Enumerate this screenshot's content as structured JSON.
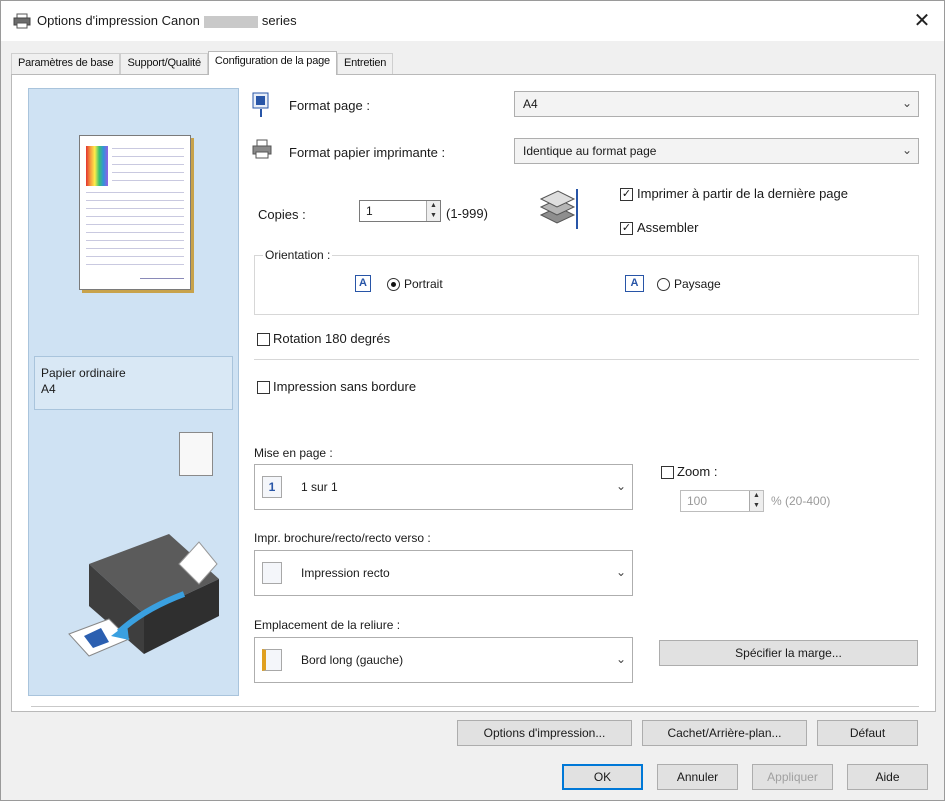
{
  "window": {
    "title_prefix": "Options d'impression Canon",
    "title_suffix": "series",
    "close_glyph": "✕"
  },
  "tabs": [
    {
      "label": "Paramètres de base",
      "active": false
    },
    {
      "label": "Support/Qualité",
      "active": false
    },
    {
      "label": "Configuration de la page",
      "active": true
    },
    {
      "label": "Entretien",
      "active": false
    }
  ],
  "preview": {
    "media_type": "Papier ordinaire",
    "media_size": "A4"
  },
  "page_setup": {
    "page_size_label": "Format page :",
    "page_size_value": "A4",
    "printer_paper_label": "Format papier imprimante :",
    "printer_paper_value": "Identique au format page",
    "copies_label": "Copies :",
    "copies_value": "1",
    "copies_range": "(1-999)",
    "print_from_last_label": "Imprimer à partir de la dernière page",
    "print_from_last_checked": true,
    "collate_label": "Assembler",
    "collate_checked": true,
    "orientation_label": "Orientation :",
    "portrait_label": "Portrait",
    "portrait_icon_glyph": "A",
    "landscape_label": "Paysage",
    "landscape_icon_glyph": "A",
    "orientation_selected": "portrait",
    "rotate_label": "Rotation 180 degrés",
    "rotate_checked": false,
    "borderless_label": "Impression sans bordure",
    "borderless_checked": false
  },
  "layout": {
    "label": "Mise en page :",
    "icon_glyph": "1",
    "value": "1 sur 1",
    "zoom_label": "Zoom :",
    "zoom_checked": false,
    "zoom_value": "100",
    "zoom_range": "% (20-400)"
  },
  "duplex": {
    "label": "Impr. brochure/recto/recto verso :",
    "value": "Impression recto"
  },
  "binding": {
    "label": "Emplacement de la reliure :",
    "value": "Bord long (gauche)",
    "margin_button": "Spécifier la marge..."
  },
  "footer": {
    "print_options": "Options d'impression...",
    "stamp_background": "Cachet/Arrière-plan...",
    "defaults": "Défaut",
    "ok": "OK",
    "cancel": "Annuler",
    "apply": "Appliquer",
    "help": "Aide"
  },
  "icons": {
    "dropdown": "chevron-down-icon",
    "check_glyph": "✓",
    "dropdown_glyph": "⌄",
    "spin_up_glyph": "▲",
    "spin_down_glyph": "▼"
  },
  "colors": {
    "preview_bg": "#cfe2f3",
    "accent": "#0078d7",
    "orientation_icon": "#2855a7"
  }
}
